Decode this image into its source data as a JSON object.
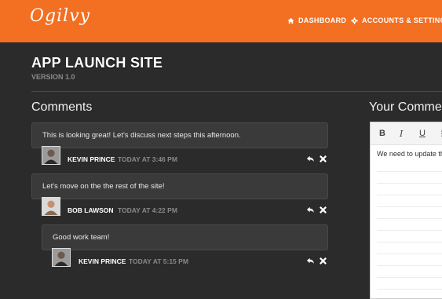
{
  "header": {
    "logo": "Ogilvy",
    "nav": [
      {
        "label": "DASHBOARD",
        "icon": "home-icon"
      },
      {
        "label": "ACCOUNTS & SETTINGS",
        "icon": "gear-icon"
      }
    ]
  },
  "page": {
    "title": "APP LAUNCH SITE",
    "version": "VERSION 1.0"
  },
  "comments_section": {
    "heading": "Comments",
    "items": [
      {
        "text": "This is looking great! Let's discuss next steps this afternoon.",
        "author": "KEVIN PRINCE",
        "time": "TODAY AT 3:46 PM"
      },
      {
        "text": "Let's move on the the rest of the site!",
        "author": "BOB LAWSON",
        "time": "TODAY AT 4:22 PM"
      },
      {
        "text": "Good work team!",
        "author": "KEVIN PRINCE",
        "time": "TODAY AT 5:15 PM"
      }
    ]
  },
  "your_comment": {
    "heading": "Your Comment",
    "toolbar": {
      "bold": "B",
      "italic": "I",
      "underline": "U",
      "list": "⋮"
    },
    "draft_text": "We need to update th"
  },
  "colors": {
    "brand_orange": "#f36f21",
    "background": "#2b2b2b",
    "comment_box": "#3a3a3a"
  }
}
